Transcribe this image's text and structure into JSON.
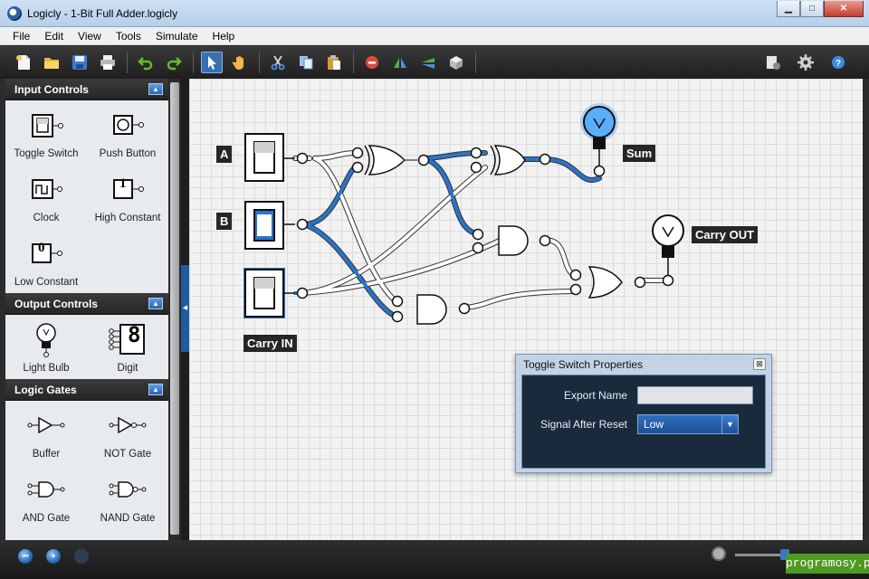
{
  "window": {
    "title": "Logicly - 1-Bit Full Adder.logicly",
    "min": "▁",
    "max": "□",
    "close": "✕"
  },
  "menu": [
    "File",
    "Edit",
    "View",
    "Tools",
    "Simulate",
    "Help"
  ],
  "toolbar": {
    "tools": [
      "new-file-icon",
      "open-folder-icon",
      "save-icon",
      "print-icon",
      "undo-icon",
      "redo-icon",
      "pointer-icon",
      "hand-icon",
      "cut-icon",
      "copy-icon",
      "paste-icon",
      "delete-icon",
      "flip-horizontal-icon",
      "flip-vertical-icon",
      "rotate-icon"
    ],
    "right_tools": [
      "export-icon",
      "settings-gear-icon",
      "help-icon"
    ]
  },
  "sidebar": {
    "sections": [
      {
        "title": "Input Controls",
        "items": [
          "Toggle Switch",
          "Push Button",
          "Clock",
          "High Constant",
          "Low Constant"
        ]
      },
      {
        "title": "Output Controls",
        "items": [
          "Light Bulb",
          "Digit"
        ]
      },
      {
        "title": "Logic Gates",
        "items": [
          "Buffer",
          "NOT Gate",
          "AND Gate",
          "NAND Gate"
        ]
      }
    ],
    "collapse_glyph": "▲",
    "high_constant_value": "1",
    "low_constant_value": "0",
    "digit_value": "8"
  },
  "splitter": {
    "grip_glyph": "◀"
  },
  "circuit": {
    "labels": {
      "a": "A",
      "b": "B",
      "carry_in": "Carry IN",
      "sum": "Sum",
      "carry_out": "Carry OUT"
    },
    "accent_on": "#2a74c8",
    "accent_off": "#ffffff"
  },
  "dialog": {
    "title": "Toggle Switch Properties",
    "close_glyph": "⊠",
    "export_name_label": "Export Name",
    "export_name_value": "",
    "signal_label": "Signal After Reset",
    "signal_value": "Low",
    "select_arrow": "▼"
  },
  "bottom": {
    "rewind": "⏮",
    "pause": "⏸",
    "zoom_level": 0.45
  },
  "watermark": "programosy.pl"
}
